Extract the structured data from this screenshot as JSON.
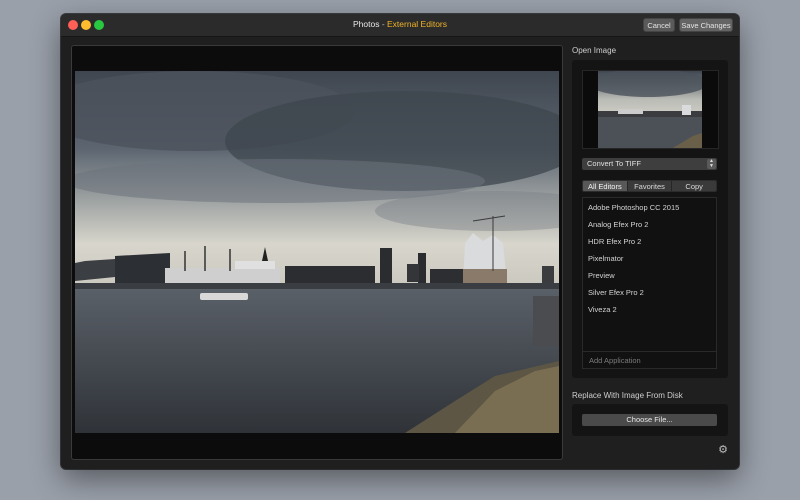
{
  "window": {
    "app_name": "Photos",
    "title_separator": " - ",
    "title_section": "External Editors",
    "cancel_label": "Cancel",
    "save_label": "Save Changes"
  },
  "sidebar": {
    "open_image_label": "Open Image",
    "convert_select_value": "Convert To TIFF",
    "tabs": [
      {
        "label": "All Editors",
        "active": true
      },
      {
        "label": "Favorites",
        "active": false
      },
      {
        "label": "Copy",
        "active": false
      }
    ],
    "applications": [
      "Adobe Photoshop CC 2015",
      "Analog Efex Pro 2",
      "HDR Efex Pro 2",
      "Pixelmator",
      "Preview",
      "Silver Efex Pro 2",
      "Viveza 2"
    ],
    "add_application_placeholder": "Add Application",
    "replace_label": "Replace With Image From Disk",
    "choose_file_label": "Choose File..."
  },
  "icons": {
    "settings": "gear-icon",
    "select_arrows": "up-down-arrows-icon"
  },
  "colors": {
    "title_accent": "#f0b429",
    "close": "#fe5f57",
    "minimize": "#febc2e",
    "maximize": "#28c840"
  }
}
